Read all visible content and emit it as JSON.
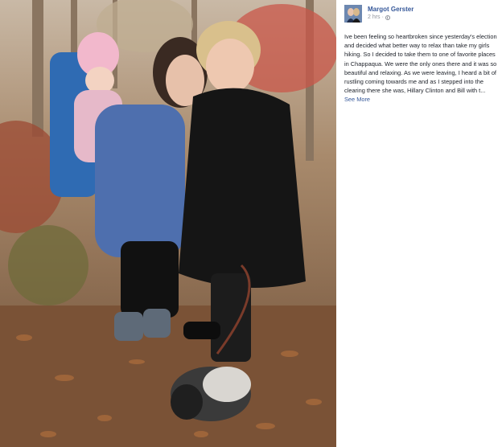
{
  "post": {
    "author_name": "Margot Gerster",
    "timestamp": "2 hrs",
    "privacy_icon": "globe-icon",
    "body_text": "Ive been feeling so heartbroken since yesterday's election and decided what better way to relax than take my girls hiking. So I decided to take them to one of favorite places in Chappaqua. We were the only ones there and it was so beautiful and relaxing. As we were leaving, I heard a bit of rustling coming towards me and as I stepped into the clearing there she was, Hillary Clinton and Bill with t...",
    "see_more_label": "See More"
  },
  "colors": {
    "link": "#365899",
    "text": "#1d2129",
    "meta": "#90949c"
  }
}
